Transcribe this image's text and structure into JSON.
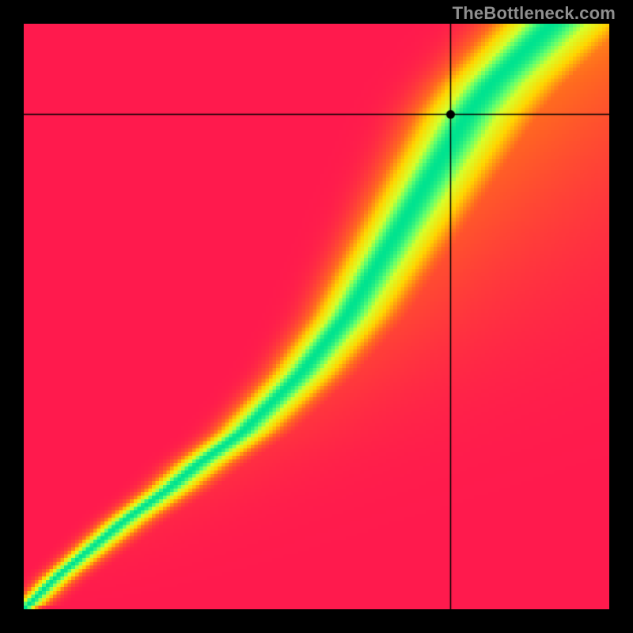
{
  "watermark": "TheBottleneck.com",
  "chart_data": {
    "type": "heatmap",
    "title": "",
    "xlabel": "",
    "ylabel": "",
    "xlim": [
      0,
      1
    ],
    "ylim": [
      0,
      1
    ],
    "grid": false,
    "crosshair": {
      "x": 0.73,
      "y": 0.845
    },
    "marker": {
      "x": 0.73,
      "y": 0.845
    },
    "ridge": {
      "description": "optimal x for each y; heat value peaks (green) along this curve and falls off to red away from it",
      "points": [
        {
          "y": 0.0,
          "x": 0.0
        },
        {
          "y": 0.05,
          "x": 0.05
        },
        {
          "y": 0.1,
          "x": 0.11
        },
        {
          "y": 0.15,
          "x": 0.17
        },
        {
          "y": 0.2,
          "x": 0.24
        },
        {
          "y": 0.25,
          "x": 0.3
        },
        {
          "y": 0.3,
          "x": 0.37
        },
        {
          "y": 0.35,
          "x": 0.42
        },
        {
          "y": 0.4,
          "x": 0.47
        },
        {
          "y": 0.45,
          "x": 0.51
        },
        {
          "y": 0.5,
          "x": 0.55
        },
        {
          "y": 0.55,
          "x": 0.58
        },
        {
          "y": 0.6,
          "x": 0.61
        },
        {
          "y": 0.65,
          "x": 0.64
        },
        {
          "y": 0.7,
          "x": 0.67
        },
        {
          "y": 0.75,
          "x": 0.7
        },
        {
          "y": 0.8,
          "x": 0.73
        },
        {
          "y": 0.85,
          "x": 0.76
        },
        {
          "y": 0.9,
          "x": 0.8
        },
        {
          "y": 0.95,
          "x": 0.85
        },
        {
          "y": 1.0,
          "x": 0.9
        }
      ]
    },
    "colorscale": [
      {
        "stop": 0.0,
        "color": "#ff1a4d"
      },
      {
        "stop": 0.3,
        "color": "#ff6a1f"
      },
      {
        "stop": 0.55,
        "color": "#ffd500"
      },
      {
        "stop": 0.78,
        "color": "#d7ff2a"
      },
      {
        "stop": 0.9,
        "color": "#62ff6e"
      },
      {
        "stop": 1.0,
        "color": "#00e38f"
      }
    ],
    "peak_halfwidth_x": 0.06,
    "falloff_right_scale": 1.35
  }
}
